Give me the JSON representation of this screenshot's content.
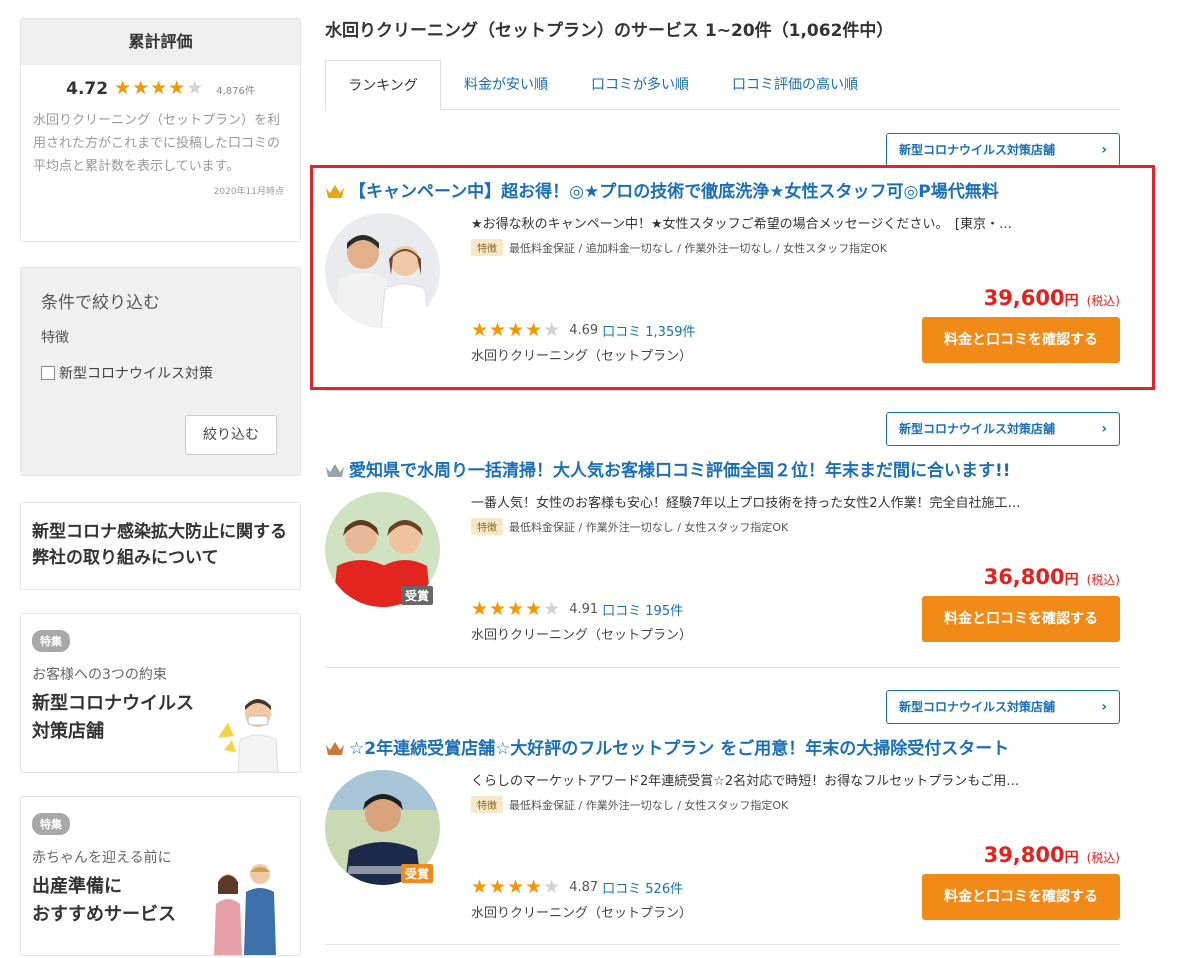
{
  "sidebar": {
    "rating": {
      "heading": "累計評価",
      "score": "4.72",
      "stars": "★★★★",
      "stars_off": "★",
      "count": "4,876件",
      "description": "水回りクリーニング（セットプラン）を利用された方がこれまでに投稿した口コミの平均点と累計数を表示しています。",
      "date": "2020年11月時点"
    },
    "filter": {
      "title": "条件で絞り込む",
      "subtitle": "特徴",
      "checkbox_label": "新型コロナウイルス対策",
      "button": "絞り込む"
    },
    "corona_notice": "新型コロナ感染拡大防止に関する弊社の取り組みについて",
    "feature1": {
      "badge": "特集",
      "sub": "お客様への3つの約束",
      "main_line1": "新型コロナウイルス",
      "main_line2": "対策店舗"
    },
    "feature2": {
      "badge": "特集",
      "sub": "赤ちゃんを迎える前に",
      "main_line1": "出産準備に",
      "main_line2": "おすすめサービス"
    }
  },
  "main": {
    "page_title": "水回りクリーニング（セットプラン）のサービス 1~20件（1,062件中）",
    "tabs": [
      "ランキング",
      "料金が安い順",
      "口コミが多い順",
      "口コミ評価の高い順"
    ],
    "listings": [
      {
        "covid_tag": "新型コロナウイルス対策店舗",
        "chevron": "›",
        "title": "【キャンペーン中】超お得！◎★プロの技術で徹底洗浄★女性スタッフ可◎P場代無料",
        "catch": "★お得な秋のキャンペーン中！★女性スタッフご希望の場合メッセージください。　[東京・…",
        "feature_badge": "特徴",
        "features": "最低料金保証 / 追加料金一切なし / 作業外注一切なし / 女性スタッフ指定OK",
        "price": "39,600",
        "price_unit": "円",
        "price_tax": "(税込)",
        "cta": "料金と口コミを確認する",
        "stars": "★★★★",
        "stars_off": "★",
        "score": "4.69",
        "reviews": "口コミ 1,359件",
        "category": "水回りクリーニング（セットプラン）",
        "crown_color": "#e6a817",
        "avatar_badge": ""
      },
      {
        "covid_tag": "新型コロナウイルス対策店舗",
        "chevron": "›",
        "title": "愛知県で水周り一括清掃！大人気お客様口コミ評価全国２位！年末まだ間に合います!!",
        "catch": "一番人気！女性のお客様も安心！経験7年以上プロ技術を持った女性2人作業！完全自社施工…",
        "feature_badge": "特徴",
        "features": "最低料金保証 / 作業外注一切なし / 女性スタッフ指定OK",
        "price": "36,800",
        "price_unit": "円",
        "price_tax": "(税込)",
        "cta": "料金と口コミを確認する",
        "stars": "★★★★",
        "stars_off": "★",
        "score": "4.91",
        "reviews": "口コミ 195件",
        "category": "水回りクリーニング（セットプラン）",
        "crown_color": "#9aa3ad",
        "avatar_badge": "受賞"
      },
      {
        "covid_tag": "新型コロナウイルス対策店舗",
        "chevron": "›",
        "title": "☆2年連続受賞店舗☆大好評のフルセットプラン をご用意！年末の大掃除受付スタート",
        "catch": "くらしのマーケットアワード2年連続受賞☆2名対応で時短！お得なフルセットプランもご用…",
        "feature_badge": "特徴",
        "features": "最低料金保証 / 作業外注一切なし / 女性スタッフ指定OK",
        "price": "39,800",
        "price_unit": "円",
        "price_tax": "(税込)",
        "cta": "料金と口コミを確認する",
        "stars": "★★★★",
        "stars_off": "★",
        "score": "4.87",
        "reviews": "口コミ 526件",
        "category": "水回りクリーニング（セットプラン）",
        "crown_color": "#c97a3a",
        "avatar_badge": "受賞"
      }
    ]
  },
  "colors": {
    "link_blue": "#1a6fb6",
    "price_red": "#e3211f",
    "cta_orange": "#f28a18",
    "star_orange": "#f39800",
    "highlight_red": "#e0262c"
  }
}
